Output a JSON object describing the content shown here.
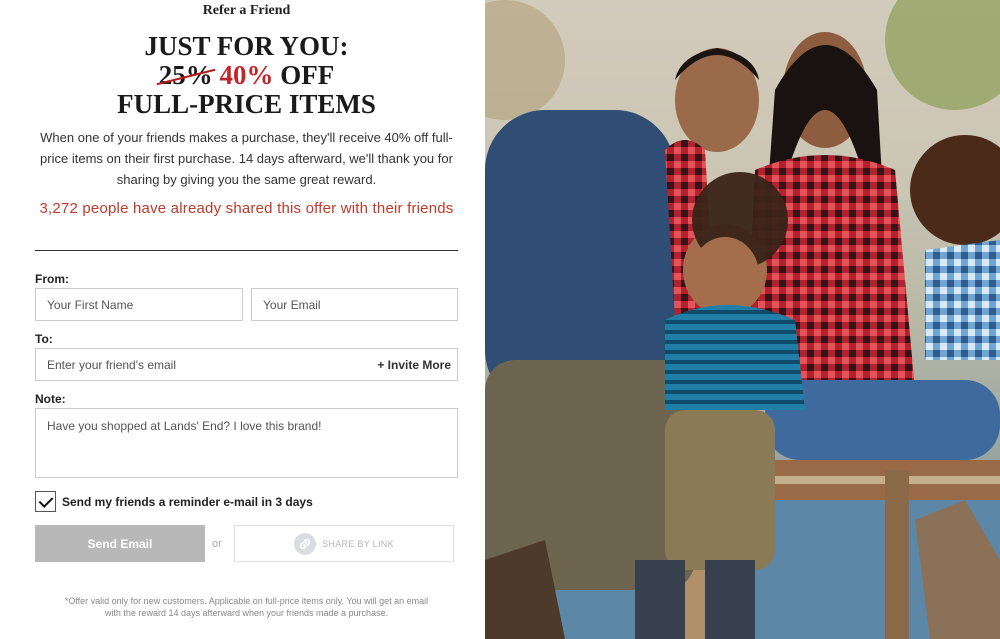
{
  "modal": {
    "title": "Refer a Friend"
  },
  "headline": {
    "line1": "JUST FOR YOU:",
    "old_discount": "25%",
    "new_discount": "40%",
    "off": "OFF",
    "line3": "FULL-PRICE ITEMS"
  },
  "description": "When one of your friends makes a purchase, they'll receive 40% off full-price items on their first purchase. 14 days afterward, we'll thank you for sharing by giving you the same great reward.",
  "shared_count_text": "3,272 people have already shared this offer with their friends",
  "form": {
    "from_label": "From:",
    "first_name_placeholder": "Your First Name",
    "email_placeholder": "Your Email",
    "to_label": "To:",
    "friend_email_placeholder": "Enter your friend's email",
    "invite_more": "+ Invite More",
    "note_label": "Note:",
    "note_value": "Have you shopped at Lands' End? I love this brand!",
    "reminder_label": "Send my friends a reminder e-mail in 3 days",
    "reminder_checked": true,
    "send_label": "Send Email",
    "or_label": "or",
    "share_link_label": "SHARE BY LINK"
  },
  "disclaimer": "*Offer valid only for new customers. Applicable on full-price items only. You will get an email with the reward 14 days afterward when your friends made a purchase.",
  "icons": {
    "check": "check-icon",
    "link": "link-icon"
  },
  "colors": {
    "accent_red": "#c0392b",
    "button_disabled": "#b8b8b8"
  }
}
